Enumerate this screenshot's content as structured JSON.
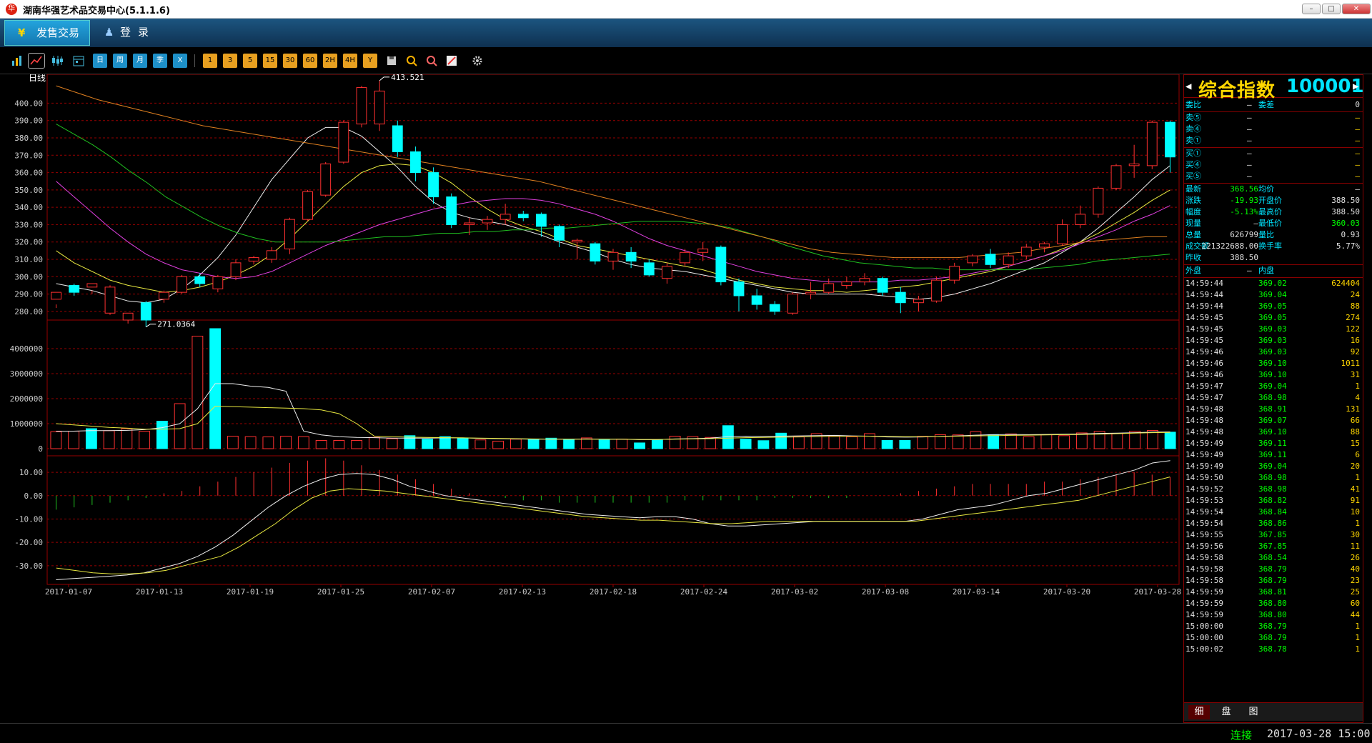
{
  "window": {
    "title": "湖南华强艺术品交易中心(5.1.1.6)",
    "logo": "华",
    "controls": {
      "min": "–",
      "max": "□",
      "close": "✕"
    }
  },
  "menubar": {
    "sale_icon": "¥",
    "sale_label": "发售交易",
    "login_icon": "♟",
    "login_label": "登录"
  },
  "toolbar": {
    "icons": [
      "bar-chart-icon",
      "line-chart-icon",
      "candle-icon",
      "calendar-icon"
    ],
    "period_buttons": [
      "日",
      "周",
      "月",
      "季",
      "X"
    ],
    "minute_buttons": [
      "1",
      "3",
      "5",
      "15",
      "30",
      "60",
      "2H",
      "4H",
      "Y"
    ],
    "tool_icons": [
      "save-icon",
      "zoom-in-icon",
      "zoom-out-icon",
      "draw-icon",
      "settings-icon"
    ]
  },
  "chart_data": {
    "type": "candlestick",
    "period_label": "日线",
    "max_label": "413.521",
    "min_label": "271.0364",
    "price_ticks": [
      "400.00",
      "390.00",
      "380.00",
      "370.00",
      "360.00",
      "350.00",
      "340.00",
      "330.00",
      "320.00",
      "310.00",
      "300.00",
      "290.00",
      "280.00"
    ],
    "volume_ticks": [
      "4000000",
      "3000000",
      "2000000",
      "1000000",
      "0"
    ],
    "macd_ticks": [
      "10.00",
      "0.00",
      "-10.00",
      "-20.00",
      "-30.00"
    ],
    "x_labels": [
      "2017-01-07",
      "2017-01-13",
      "2017-01-19",
      "2017-01-25",
      "2017-02-07",
      "2017-02-13",
      "2017-02-18",
      "2017-02-24",
      "2017-03-02",
      "2017-03-08",
      "2017-03-14",
      "2017-03-20",
      "2017-03-28"
    ],
    "ylim": [
      275,
      415
    ],
    "candles": [
      [
        287,
        291,
        284,
        282
      ],
      [
        295,
        291,
        296,
        289
      ],
      [
        294,
        296,
        292,
        290
      ],
      [
        279,
        294,
        295,
        278
      ],
      [
        275,
        279,
        279,
        273
      ],
      [
        285,
        275,
        286,
        271
      ],
      [
        287,
        291,
        292,
        285
      ],
      [
        291,
        300,
        301,
        290
      ],
      [
        300,
        296,
        302,
        294
      ],
      [
        293,
        300,
        301,
        291
      ],
      [
        300,
        308,
        310,
        298
      ],
      [
        309,
        311,
        312,
        307
      ],
      [
        310,
        315,
        317,
        308
      ],
      [
        316,
        333,
        334,
        313
      ],
      [
        333,
        349,
        350,
        332
      ],
      [
        347,
        365,
        366,
        346
      ],
      [
        366,
        389,
        390,
        365
      ],
      [
        388,
        409,
        410,
        386
      ],
      [
        388,
        407,
        413,
        384
      ],
      [
        387,
        372,
        390,
        369
      ],
      [
        372,
        360,
        375,
        355
      ],
      [
        360,
        346,
        363,
        342
      ],
      [
        346,
        330,
        348,
        328
      ],
      [
        330,
        331,
        334,
        324
      ],
      [
        331,
        333,
        335,
        327
      ],
      [
        333,
        336,
        342,
        330
      ],
      [
        336,
        334,
        338,
        332
      ],
      [
        336,
        329,
        337,
        323
      ],
      [
        329,
        321,
        330,
        317
      ],
      [
        320,
        321,
        322,
        310
      ],
      [
        319,
        309,
        320,
        307
      ],
      [
        309,
        314,
        316,
        304
      ],
      [
        314,
        309,
        317,
        305
      ],
      [
        308,
        301,
        310,
        300
      ],
      [
        299,
        306,
        308,
        296
      ],
      [
        308,
        314,
        316,
        306
      ],
      [
        314,
        316,
        320,
        309
      ],
      [
        317,
        297,
        318,
        295
      ],
      [
        297,
        289,
        299,
        280
      ],
      [
        289,
        284,
        293,
        281
      ],
      [
        284,
        280,
        286,
        278
      ],
      [
        279,
        290,
        291,
        278
      ],
      [
        290,
        291,
        297,
        287
      ],
      [
        291,
        296,
        299,
        290
      ],
      [
        295,
        297,
        300,
        293
      ],
      [
        297,
        299,
        302,
        295
      ],
      [
        299,
        291,
        300,
        289
      ],
      [
        291,
        285,
        294,
        279
      ],
      [
        285,
        287,
        289,
        280
      ],
      [
        286,
        298,
        300,
        285
      ],
      [
        298,
        306,
        308,
        296
      ],
      [
        308,
        312,
        313,
        306
      ],
      [
        313,
        307,
        316,
        305
      ],
      [
        307,
        312,
        314,
        305
      ],
      [
        312,
        317,
        319,
        310
      ],
      [
        317,
        319,
        320,
        314
      ],
      [
        319,
        330,
        333,
        318
      ],
      [
        330,
        336,
        341,
        328
      ],
      [
        336,
        351,
        352,
        334
      ],
      [
        351,
        364,
        365,
        350
      ],
      [
        364,
        365,
        376,
        357
      ],
      [
        364,
        389,
        390,
        362
      ],
      [
        389,
        369,
        390,
        360
      ]
    ],
    "volume": [
      680000,
      700000,
      800000,
      720000,
      800000,
      700000,
      1100000,
      1800000,
      4500000,
      4800000,
      500000,
      480000,
      470000,
      500000,
      480000,
      330000,
      330000,
      330000,
      450000,
      400000,
      520000,
      380000,
      480000,
      430000,
      350000,
      300000,
      380000,
      360000,
      420000,
      370000,
      430000,
      350000,
      380000,
      230000,
      350000,
      500000,
      480000,
      450000,
      920000,
      380000,
      320000,
      620000,
      480000,
      600000,
      520000,
      480000,
      600000,
      330000,
      330000,
      490000,
      560000,
      550000,
      680000,
      560000,
      590000,
      480000,
      560000,
      520000,
      630000,
      690000,
      610000,
      700000,
      730000,
      660000
    ],
    "ma_lines": {
      "white": [
        296,
        294,
        292,
        289,
        286,
        285,
        287,
        293,
        301,
        311,
        324,
        340,
        356,
        368,
        380,
        386,
        386,
        381,
        372,
        363,
        352,
        343,
        337,
        334,
        332,
        330,
        327,
        324,
        320,
        317,
        314,
        310,
        307,
        305,
        304,
        303,
        301,
        299,
        297,
        295,
        293,
        291,
        290,
        290,
        290,
        290,
        289,
        288,
        287,
        288,
        290,
        293,
        296,
        300,
        304,
        308,
        314,
        320,
        328,
        337,
        346,
        356,
        364
      ],
      "yellow": [
        315,
        308,
        303,
        298,
        295,
        293,
        291,
        292,
        294,
        297,
        301,
        306,
        313,
        322,
        332,
        342,
        352,
        360,
        364,
        365,
        364,
        360,
        354,
        346,
        339,
        333,
        329,
        326,
        322,
        318,
        316,
        314,
        312,
        310,
        308,
        306,
        304,
        301,
        298,
        296,
        294,
        293,
        292,
        292,
        291,
        292,
        293,
        294,
        295,
        297,
        299,
        301,
        303,
        306,
        309,
        312,
        316,
        320,
        325,
        331,
        337,
        344,
        350
      ],
      "magenta": [
        355,
        346,
        337,
        328,
        320,
        313,
        308,
        304,
        302,
        300,
        299,
        300,
        303,
        308,
        313,
        318,
        322,
        326,
        330,
        333,
        336,
        339,
        341,
        343,
        344,
        345,
        345,
        344,
        342,
        339,
        336,
        332,
        327,
        322,
        318,
        315,
        312,
        309,
        306,
        303,
        301,
        299,
        298,
        297,
        297,
        297,
        297,
        298,
        298,
        299,
        300,
        302,
        304,
        306,
        309,
        312,
        315,
        319,
        323,
        327,
        332,
        336,
        341
      ],
      "green": [
        388,
        382,
        376,
        369,
        361,
        354,
        346,
        340,
        334,
        329,
        325,
        322,
        320,
        320,
        320,
        320,
        321,
        322,
        323,
        323,
        324,
        325,
        325,
        326,
        326,
        327,
        327,
        328,
        328,
        329,
        330,
        331,
        332,
        332,
        332,
        331,
        330,
        328,
        325,
        322,
        318,
        315,
        312,
        310,
        308,
        307,
        306,
        305,
        305,
        304,
        304,
        304,
        304,
        304,
        305,
        306,
        307,
        309,
        310,
        311,
        312,
        313
      ],
      "orange": [
        410,
        406,
        402,
        399,
        396,
        393,
        390,
        387,
        385,
        383,
        381,
        379,
        377,
        375,
        373,
        371,
        369,
        367,
        365,
        363,
        361,
        359,
        357,
        355,
        352,
        349,
        346,
        343,
        340,
        337,
        334,
        331,
        328,
        325,
        322,
        319,
        316,
        314,
        313,
        312,
        311,
        311,
        311,
        311,
        312,
        313,
        314,
        316,
        318,
        320,
        321,
        322,
        323,
        323
      ]
    },
    "vol_ma": {
      "white": [
        700000,
        700000,
        720000,
        720000,
        730000,
        760000,
        840000,
        1000000,
        1600000,
        2600000,
        2600000,
        2500000,
        2450000,
        2300000,
        700000,
        550000,
        480000,
        450000,
        440000,
        420000,
        420000,
        420000,
        430000,
        430000,
        410000,
        400000,
        390000,
        380000,
        380000,
        380000,
        390000,
        380000,
        380000,
        360000,
        360000,
        390000,
        400000,
        420000,
        480000,
        500000,
        490000,
        500000,
        510000,
        520000,
        530000,
        510000,
        500000,
        470000,
        460000,
        470000,
        490000,
        510000,
        540000,
        560000,
        570000,
        560000,
        570000,
        580000,
        590000,
        610000,
        620000,
        640000,
        660000,
        670000
      ],
      "yellow": [
        1000000,
        950000,
        900000,
        850000,
        820000,
        780000,
        780000,
        800000,
        1000000,
        1700000,
        1680000,
        1660000,
        1640000,
        1620000,
        1600000,
        1550000,
        1400000,
        1000000,
        500000,
        480000,
        460000,
        450000,
        440000,
        430000,
        420000,
        410000,
        400000,
        390000,
        385000,
        380000,
        380000,
        380000,
        380000,
        370000,
        370000,
        380000,
        390000,
        400000,
        420000,
        440000,
        450000,
        460000,
        470000,
        480000,
        490000,
        500000,
        500000,
        490000,
        480000,
        480000,
        490000,
        500000,
        510000,
        520000,
        530000,
        540000,
        550000,
        560000,
        570000,
        580000,
        600000,
        620000,
        640000,
        650000
      ]
    },
    "macd": {
      "dif": [
        -36,
        -35.5,
        -35,
        -34.5,
        -34,
        -33,
        -31,
        -29,
        -26,
        -22,
        -17,
        -11,
        -5,
        0,
        4,
        7,
        9,
        9.5,
        9,
        7,
        4,
        2,
        0,
        -1,
        -2,
        -3,
        -4,
        -5,
        -6,
        -7,
        -8,
        -8.5,
        -9,
        -9.5,
        -9,
        -9,
        -10,
        -12,
        -13,
        -13,
        -12.5,
        -12,
        -11.5,
        -11,
        -11,
        -11,
        -11,
        -11,
        -11,
        -10,
        -8,
        -6,
        -5,
        -4,
        -2,
        0,
        1,
        3,
        5,
        7,
        9,
        11,
        14,
        15
      ],
      "dea": [
        -31,
        -32,
        -33,
        -33.5,
        -33.5,
        -33,
        -32,
        -30,
        -28,
        -26,
        -22,
        -17,
        -12,
        -6,
        -1,
        2,
        3,
        2.5,
        2,
        1,
        0,
        -1,
        -2,
        -3,
        -4,
        -5,
        -6,
        -7,
        -8,
        -9,
        -9.5,
        -10,
        -10.5,
        -10.5,
        -11,
        -11.5,
        -12,
        -12,
        -11.5,
        -11,
        -11,
        -11,
        -11,
        -11,
        -11,
        -11,
        -11,
        -11,
        -10,
        -9,
        -8,
        -7,
        -6,
        -5,
        -4,
        -3,
        -2,
        0,
        2,
        4,
        6,
        8
      ],
      "hist": [
        -6,
        -5,
        -4,
        -3,
        -2,
        -1,
        1,
        2,
        4,
        6,
        8,
        10,
        12,
        14,
        15,
        16,
        15,
        13,
        11,
        9,
        7,
        5,
        3,
        1,
        0,
        -1,
        -2,
        -2,
        -3,
        -3,
        -3,
        -3,
        -3,
        -3,
        -3,
        -2,
        -2,
        -2,
        -2,
        -2,
        -1,
        -1,
        -1,
        -1,
        -1,
        0,
        0,
        1,
        2,
        3,
        4,
        5,
        5,
        5,
        5,
        6,
        6,
        7,
        8,
        9,
        10,
        9,
        8
      ]
    }
  },
  "quote_panel": {
    "title": "综合指数",
    "code": "100001",
    "weibi_label": "委比",
    "weibi_value": "—",
    "weicha_label": "委差",
    "weicha_value": "0",
    "sell": [
      {
        "label": "卖⑤",
        "price": "—",
        "vol": "—"
      },
      {
        "label": "卖④",
        "price": "—",
        "vol": "—"
      },
      {
        "label": "卖①",
        "price": "—",
        "vol": "—"
      }
    ],
    "buy": [
      {
        "label": "买①",
        "price": "—",
        "vol": "—"
      },
      {
        "label": "买④",
        "price": "—",
        "vol": "—"
      },
      {
        "label": "买⑤",
        "price": "—",
        "vol": "—"
      }
    ],
    "stats": [
      {
        "l1": "最新",
        "v1": "368.56",
        "l2": "均价",
        "v2": "—",
        "c1": "grn"
      },
      {
        "l1": "涨跌",
        "v1": "-19.93",
        "l2": "开盘价",
        "v2": "388.50",
        "c1": "grn"
      },
      {
        "l1": "幅度",
        "v1": "-5.13%",
        "l2": "最高价",
        "v2": "388.50",
        "c1": "grn"
      },
      {
        "l1": "现量",
        "v1": "—",
        "l2": "最低价",
        "v2": "360.03",
        "c1": "wht",
        "c2": "grn"
      },
      {
        "l1": "总量",
        "v1": "626799",
        "l2": "量比",
        "v2": "0.93",
        "c1": "wht"
      },
      {
        "l1": "成交额",
        "v1": "221322688.00",
        "l2": "换手率",
        "v2": "5.77%",
        "c1": "wht"
      },
      {
        "l1": "昨收",
        "v1": "388.50",
        "l2": "",
        "v2": "",
        "c1": "wht"
      }
    ],
    "waipan_label": "外盘",
    "waipan_value": "—",
    "neipan_label": "内盘",
    "ticks": [
      [
        "14:59:44",
        "369.02",
        "624404"
      ],
      [
        "14:59:44",
        "369.04",
        "24"
      ],
      [
        "14:59:44",
        "369.05",
        "88"
      ],
      [
        "14:59:45",
        "369.05",
        "274"
      ],
      [
        "14:59:45",
        "369.03",
        "122"
      ],
      [
        "14:59:45",
        "369.03",
        "16"
      ],
      [
        "14:59:46",
        "369.03",
        "92"
      ],
      [
        "14:59:46",
        "369.10",
        "1011"
      ],
      [
        "14:59:46",
        "369.10",
        "31"
      ],
      [
        "14:59:47",
        "369.04",
        "1"
      ],
      [
        "14:59:47",
        "368.98",
        "4"
      ],
      [
        "14:59:48",
        "368.91",
        "131"
      ],
      [
        "14:59:48",
        "369.07",
        "66"
      ],
      [
        "14:59:48",
        "369.10",
        "88"
      ],
      [
        "14:59:49",
        "369.11",
        "15"
      ],
      [
        "14:59:49",
        "369.11",
        "6"
      ],
      [
        "14:59:49",
        "369.04",
        "20"
      ],
      [
        "14:59:50",
        "368.98",
        "1"
      ],
      [
        "14:59:52",
        "368.98",
        "41"
      ],
      [
        "14:59:53",
        "368.82",
        "91"
      ],
      [
        "14:59:54",
        "368.84",
        "10"
      ],
      [
        "14:59:54",
        "368.86",
        "1"
      ],
      [
        "14:59:55",
        "367.85",
        "30"
      ],
      [
        "14:59:56",
        "367.85",
        "11"
      ],
      [
        "14:59:58",
        "368.54",
        "26"
      ],
      [
        "14:59:58",
        "368.79",
        "40"
      ],
      [
        "14:59:58",
        "368.79",
        "23"
      ],
      [
        "14:59:59",
        "368.81",
        "25"
      ],
      [
        "14:59:59",
        "368.80",
        "60"
      ],
      [
        "14:59:59",
        "368.80",
        "44"
      ],
      [
        "15:00:00",
        "368.79",
        "1"
      ],
      [
        "15:00:00",
        "368.79",
        "1"
      ],
      [
        "15:00:02",
        "368.78",
        "1"
      ]
    ],
    "tabs": [
      "细",
      "盘",
      "图"
    ]
  },
  "status": {
    "connection": "连接",
    "datetime": "2017-03-28 15:00"
  }
}
